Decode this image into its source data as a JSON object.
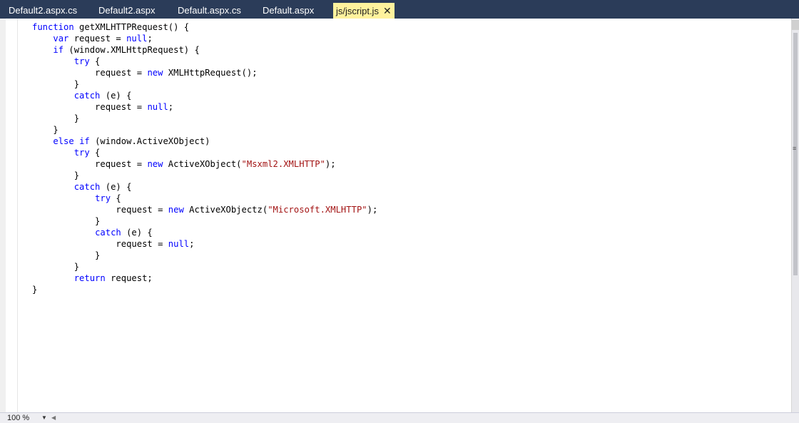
{
  "tabs": [
    {
      "label": "Default2.aspx.cs",
      "active": false
    },
    {
      "label": "Default2.aspx",
      "active": false
    },
    {
      "label": "Default.aspx.cs",
      "active": false
    },
    {
      "label": "Default.aspx",
      "active": false
    },
    {
      "label": "js/jscript.js",
      "active": true
    }
  ],
  "code_lines": [
    [
      {
        "t": "function",
        "c": "kw"
      },
      {
        "t": " getXMLHTTPRequest() {"
      }
    ],
    [
      {
        "t": "    "
      },
      {
        "t": "var",
        "c": "kw"
      },
      {
        "t": " request = "
      },
      {
        "t": "null",
        "c": "kw"
      },
      {
        "t": ";"
      }
    ],
    [
      {
        "t": "    "
      },
      {
        "t": "if",
        "c": "kw"
      },
      {
        "t": " (window.XMLHttpRequest) {"
      }
    ],
    [
      {
        "t": "        "
      },
      {
        "t": "try",
        "c": "kw"
      },
      {
        "t": " {"
      }
    ],
    [
      {
        "t": "            request = "
      },
      {
        "t": "new",
        "c": "kw"
      },
      {
        "t": " XMLHttpRequest();"
      }
    ],
    [
      {
        "t": "        }"
      }
    ],
    [
      {
        "t": "        "
      },
      {
        "t": "catch",
        "c": "kw"
      },
      {
        "t": " (e) {"
      }
    ],
    [
      {
        "t": "            request = "
      },
      {
        "t": "null",
        "c": "kw"
      },
      {
        "t": ";"
      }
    ],
    [
      {
        "t": "        }"
      }
    ],
    [
      {
        "t": "    }"
      }
    ],
    [
      {
        "t": "    "
      },
      {
        "t": "else",
        "c": "kw"
      },
      {
        "t": " "
      },
      {
        "t": "if",
        "c": "kw"
      },
      {
        "t": " (window.ActiveXObject)"
      }
    ],
    [
      {
        "t": "        "
      },
      {
        "t": "try",
        "c": "kw"
      },
      {
        "t": " {"
      }
    ],
    [
      {
        "t": "            request = "
      },
      {
        "t": "new",
        "c": "kw"
      },
      {
        "t": " ActiveXObject("
      },
      {
        "t": "\"Msxml2.XMLHTTP\"",
        "c": "str"
      },
      {
        "t": ");"
      }
    ],
    [
      {
        "t": "        }"
      }
    ],
    [
      {
        "t": "        "
      },
      {
        "t": "catch",
        "c": "kw"
      },
      {
        "t": " (e) {"
      }
    ],
    [
      {
        "t": "            "
      },
      {
        "t": "try",
        "c": "kw"
      },
      {
        "t": " {"
      }
    ],
    [
      {
        "t": "                request = "
      },
      {
        "t": "new",
        "c": "kw"
      },
      {
        "t": " ActiveXObjectz("
      },
      {
        "t": "\"Microsoft.XMLHTTP\"",
        "c": "str"
      },
      {
        "t": ");"
      }
    ],
    [
      {
        "t": "            }"
      }
    ],
    [
      {
        "t": "            "
      },
      {
        "t": "catch",
        "c": "kw"
      },
      {
        "t": " (e) {"
      }
    ],
    [
      {
        "t": "                request = "
      },
      {
        "t": "null",
        "c": "kw"
      },
      {
        "t": ";"
      }
    ],
    [
      {
        "t": "            }"
      }
    ],
    [
      {
        "t": "        }"
      }
    ],
    [
      {
        "t": "        "
      },
      {
        "t": "return",
        "c": "kw"
      },
      {
        "t": " request;"
      }
    ],
    [
      {
        "t": "}"
      }
    ]
  ],
  "status": {
    "zoom": "100 %"
  },
  "colors": {
    "keyword": "#0000ff",
    "string": "#a31515",
    "tab_bar": "#2b3c59",
    "active_tab": "#fff29d"
  }
}
